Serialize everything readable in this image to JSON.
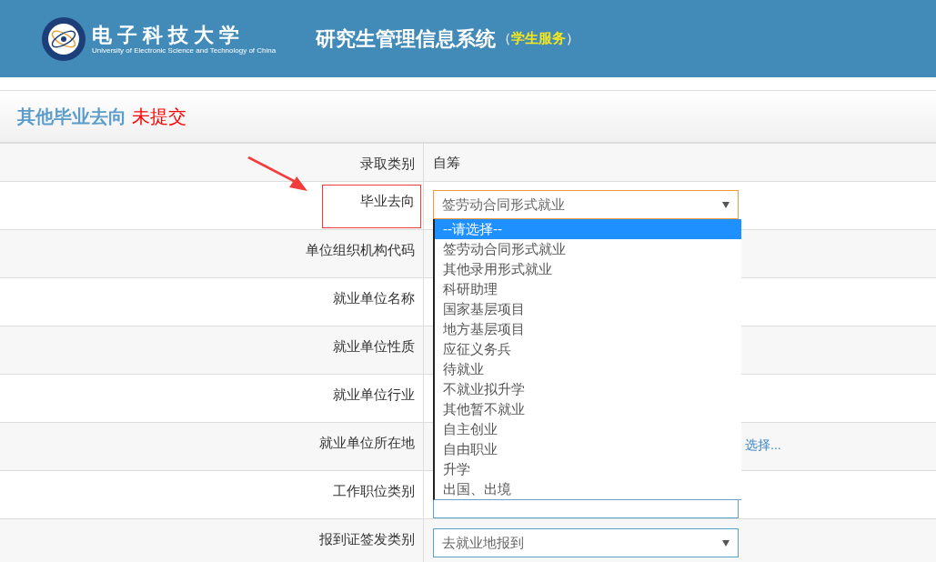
{
  "header": {
    "logo_name": "电子科技大学",
    "logo_subtitle": "University of Electronic Science and Technology of China",
    "system_title": "研究生管理信息系统",
    "system_suffix_open": "（",
    "system_suffix": "学生服务",
    "system_suffix_close": "）"
  },
  "page_title": {
    "text": "其他毕业去向",
    "status": "未提交"
  },
  "rows": [
    {
      "label": "录取类别",
      "kind": "text",
      "value": "自筹",
      "highlighted": false
    },
    {
      "label": "毕业去向",
      "kind": "select",
      "value": "签劳动合同形式就业",
      "focused": true,
      "expanded": true,
      "highlighted": true
    },
    {
      "label": "单位组织机构代码",
      "kind": "blank",
      "highlighted": false
    },
    {
      "label": "就业单位名称",
      "kind": "blank",
      "highlighted": false
    },
    {
      "label": "就业单位性质",
      "kind": "blank",
      "highlighted": false
    },
    {
      "label": "就业单位行业",
      "kind": "blank",
      "highlighted": false
    },
    {
      "label": "就业单位所在地",
      "kind": "link",
      "value": "选择...",
      "highlighted": false
    },
    {
      "label": "工作职位类别",
      "kind": "input",
      "highlighted": false
    },
    {
      "label": "报到证签发类别",
      "kind": "select",
      "value": "去就业地报到",
      "focused": false,
      "expanded": false,
      "highlighted": false
    }
  ],
  "dropdown_options": [
    {
      "label": "--请选择--",
      "selected": true
    },
    {
      "label": "签劳动合同形式就业",
      "selected": false
    },
    {
      "label": "其他录用形式就业",
      "selected": false
    },
    {
      "label": "科研助理",
      "selected": false
    },
    {
      "label": "国家基层项目",
      "selected": false
    },
    {
      "label": "地方基层项目",
      "selected": false
    },
    {
      "label": "应征义务兵",
      "selected": false
    },
    {
      "label": "待就业",
      "selected": false
    },
    {
      "label": "不就业拟升学",
      "selected": false
    },
    {
      "label": "其他暂不就业",
      "selected": false
    },
    {
      "label": "自主创业",
      "selected": false
    },
    {
      "label": "自由职业",
      "selected": false
    },
    {
      "label": "升学",
      "selected": false
    },
    {
      "label": "出国、出境",
      "selected": false
    }
  ]
}
